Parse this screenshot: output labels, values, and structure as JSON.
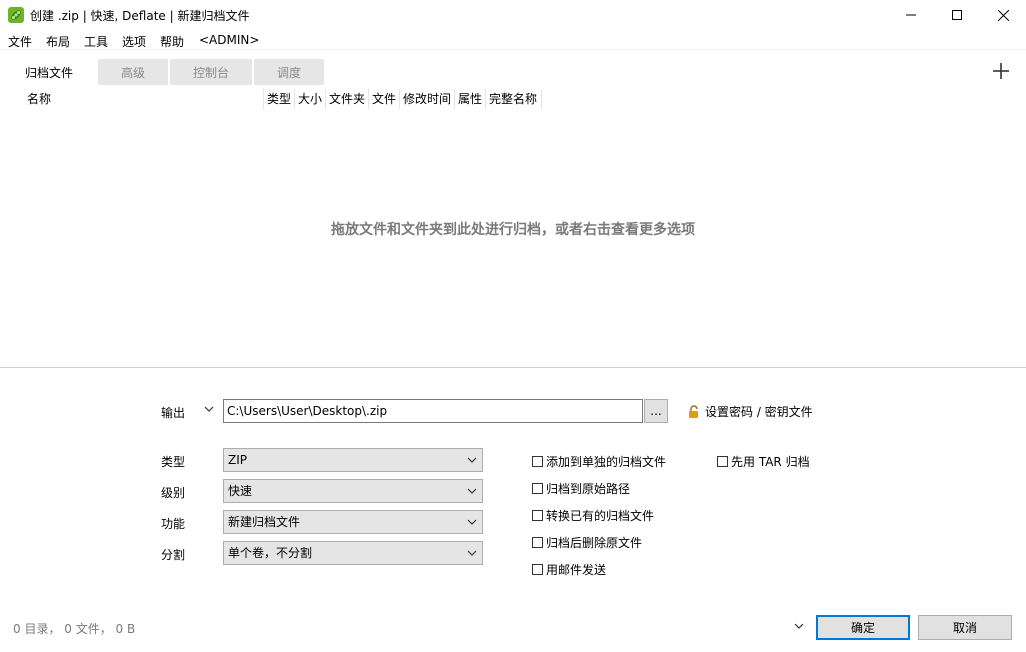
{
  "window": {
    "title": "创建 .zip | 快速, Deflate | 新建归档文件"
  },
  "menu": [
    "文件",
    "布局",
    "工具",
    "选项",
    "帮助",
    "<ADMIN>"
  ],
  "tabs": [
    {
      "label": "归档文件",
      "active": true
    },
    {
      "label": "高级",
      "active": false
    },
    {
      "label": "控制台",
      "active": false
    },
    {
      "label": "调度",
      "active": false
    }
  ],
  "columns": [
    "名称",
    "类型",
    "大小",
    "文件夹",
    "文件",
    "修改时间",
    "属性",
    "完整名称"
  ],
  "drop_hint": "拖放文件和文件夹到此处进行归档，或者右击查看更多选项",
  "output": {
    "label": "输出",
    "value": "C:\\Users\\User\\Desktop\\.zip",
    "browse_label": "...",
    "password_label": "设置密码 / 密钥文件"
  },
  "options": {
    "type": {
      "label": "类型",
      "value": "ZIP"
    },
    "level": {
      "label": "级别",
      "value": "快速"
    },
    "function": {
      "label": "功能",
      "value": "新建归档文件"
    },
    "split": {
      "label": "分割",
      "value": "单个卷，不分割"
    }
  },
  "checkboxes": {
    "add_separate": "添加到单独的归档文件",
    "to_original_path": "归档到原始路径",
    "convert_existing": "转换已有的归档文件",
    "delete_after": "归档后删除原文件",
    "send_mail": "用邮件发送",
    "tar_first": "先用 TAR 归档"
  },
  "status": "0 目录， 0 文件， 0 B",
  "buttons": {
    "ok": "确定",
    "cancel": "取消"
  },
  "colors": {
    "accent": "#0078d7",
    "padlock": "#e0a000",
    "app_icon": "#6cb52a"
  }
}
